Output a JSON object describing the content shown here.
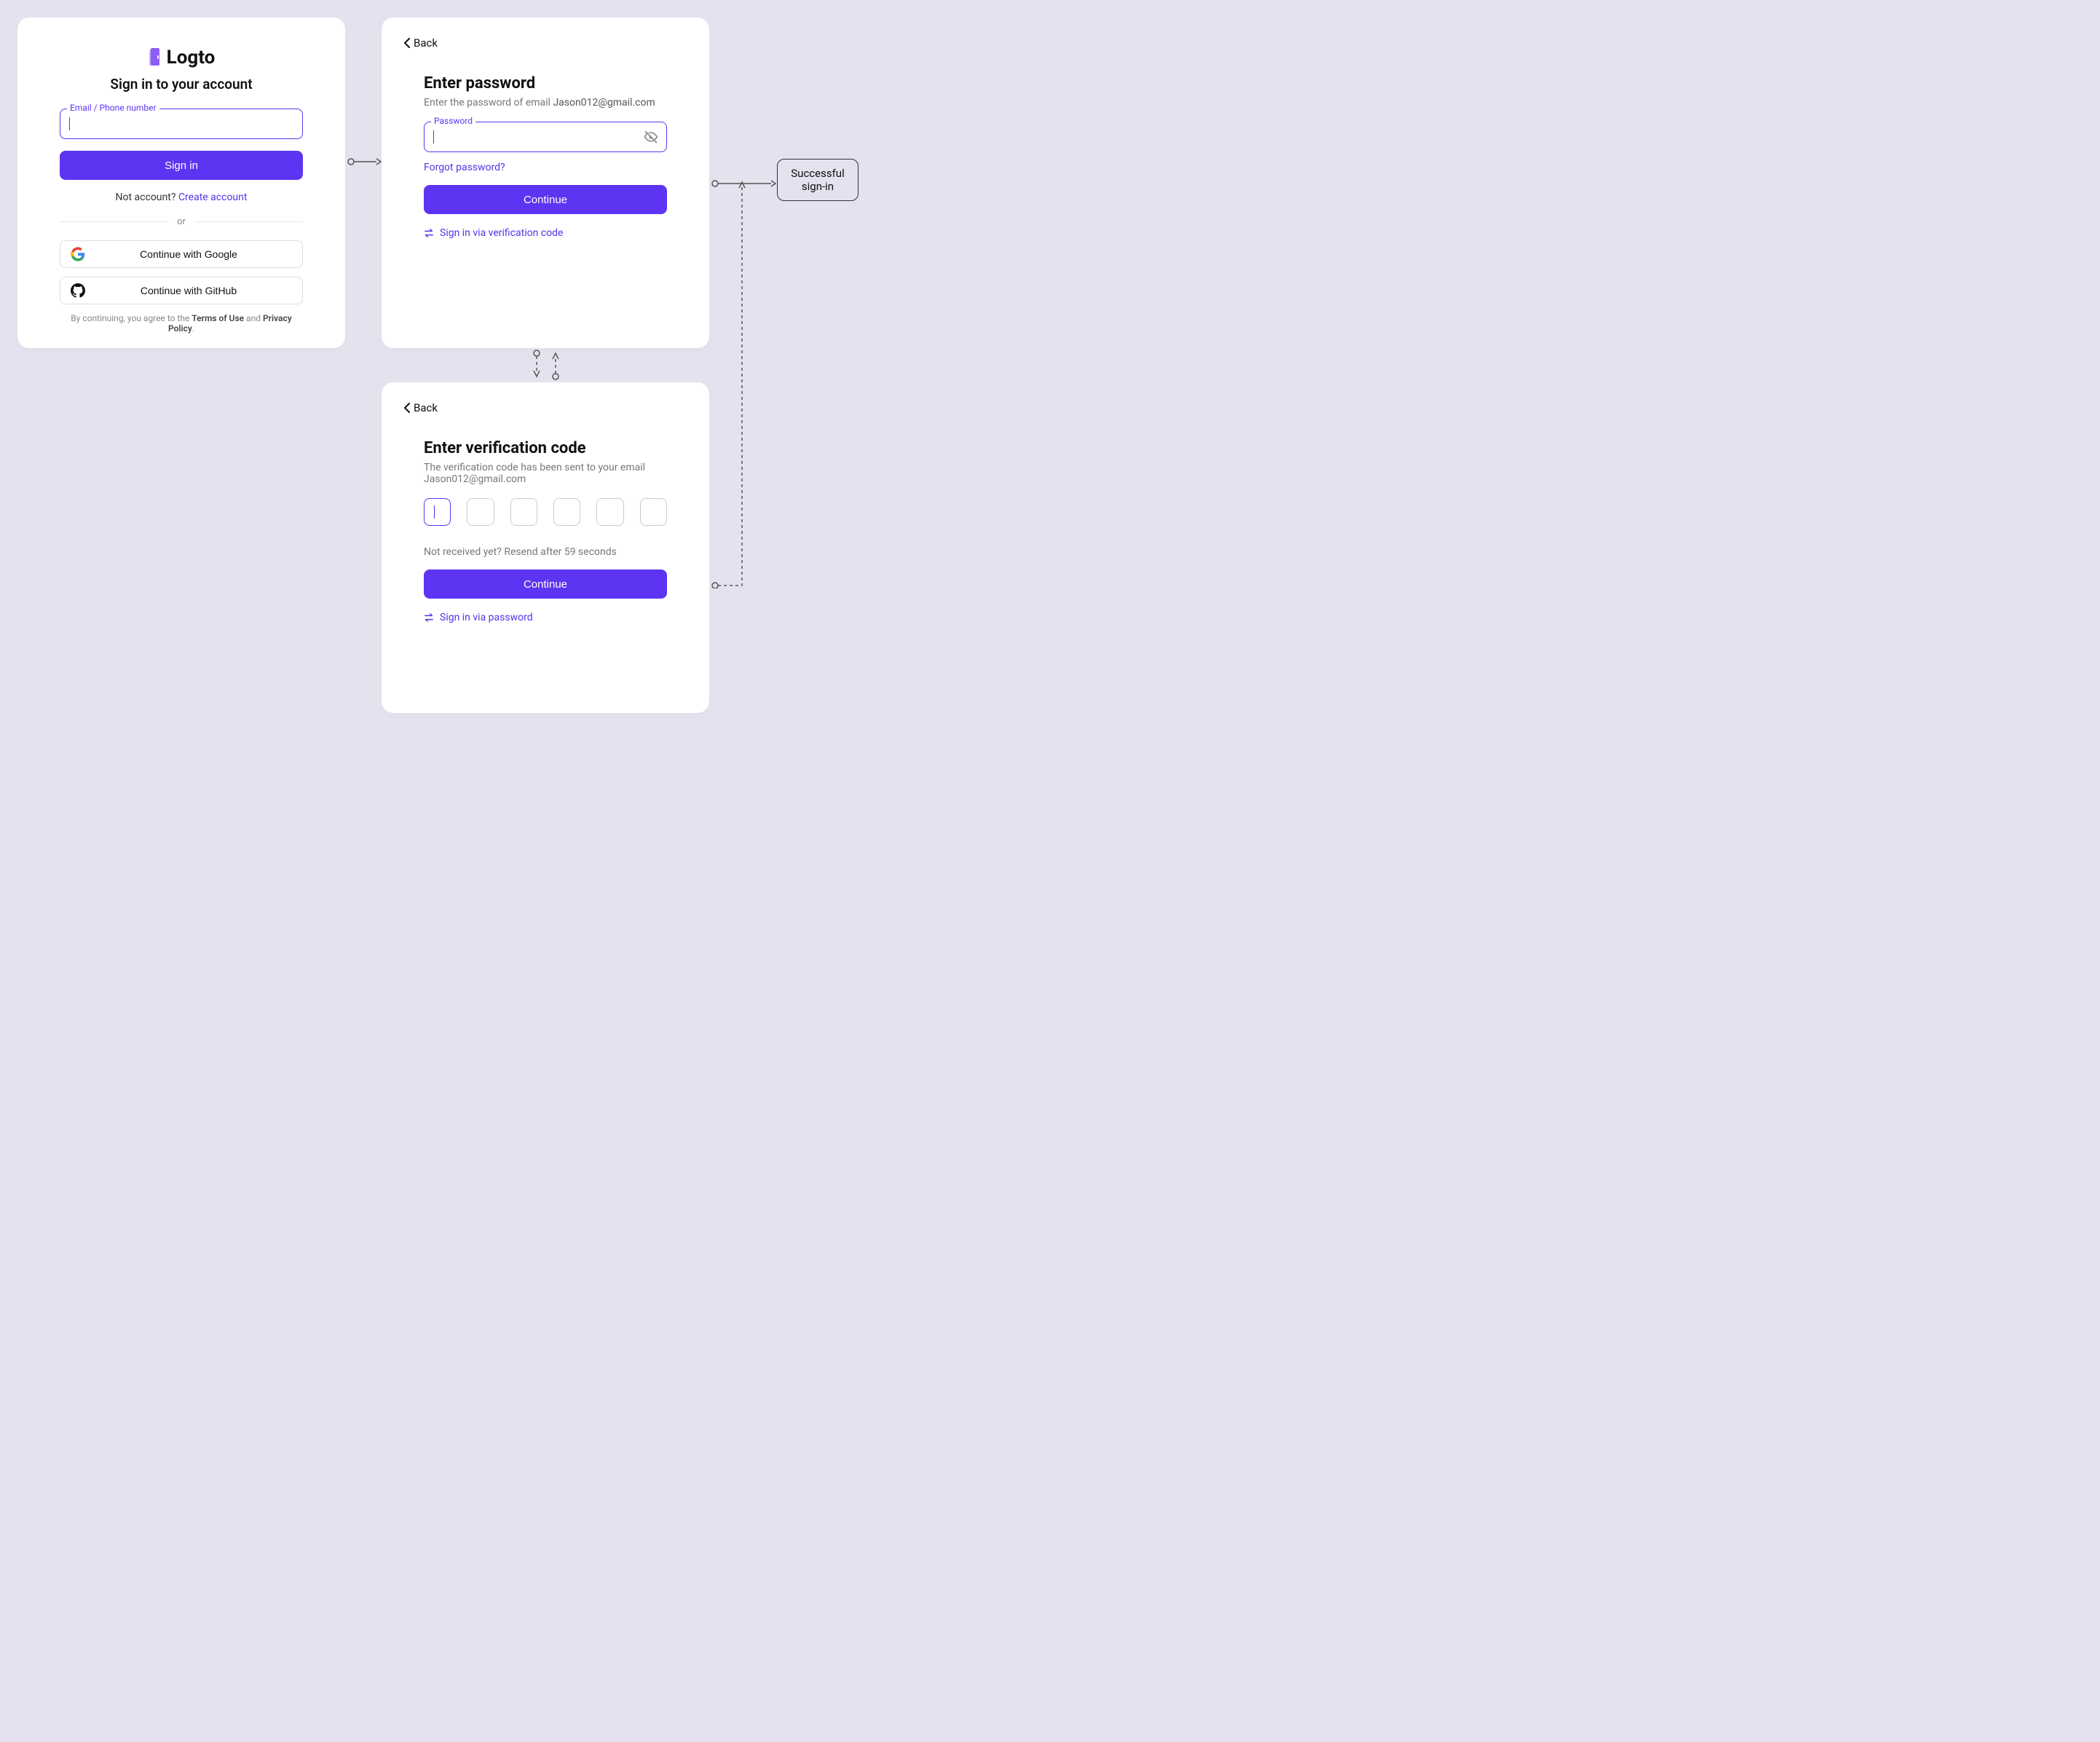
{
  "signin": {
    "brand": "Logto",
    "subtitle": "Sign in to your account",
    "id_label": "Email / Phone number",
    "signin_btn": "Sign in",
    "no_account_q": "Not account? ",
    "create_link": "Create account",
    "divider": "or",
    "google_btn": "Continue with Google",
    "github_btn": "Continue with GitHub",
    "terms_pre": "By continuing, you agree to the ",
    "terms": "Terms of Use",
    "terms_mid": " and ",
    "privacy": "Privacy Policy"
  },
  "password": {
    "back": "Back",
    "title": "Enter password",
    "sub_pre": "Enter the password of email ",
    "email": "Jason012@gmail.com",
    "pw_label": "Password",
    "forgot": "Forgot password?",
    "continue": "Continue",
    "alt_link": "Sign in via verification code"
  },
  "verify": {
    "back": "Back",
    "title": "Enter verification code",
    "sub_pre": "The verification code has been sent to your email ",
    "email": "Jason012@gmail.com",
    "resend": "Not received yet? Resend after 59 seconds",
    "continue": "Continue",
    "alt_link": "Sign in via password"
  },
  "success": "Successful sign-in"
}
